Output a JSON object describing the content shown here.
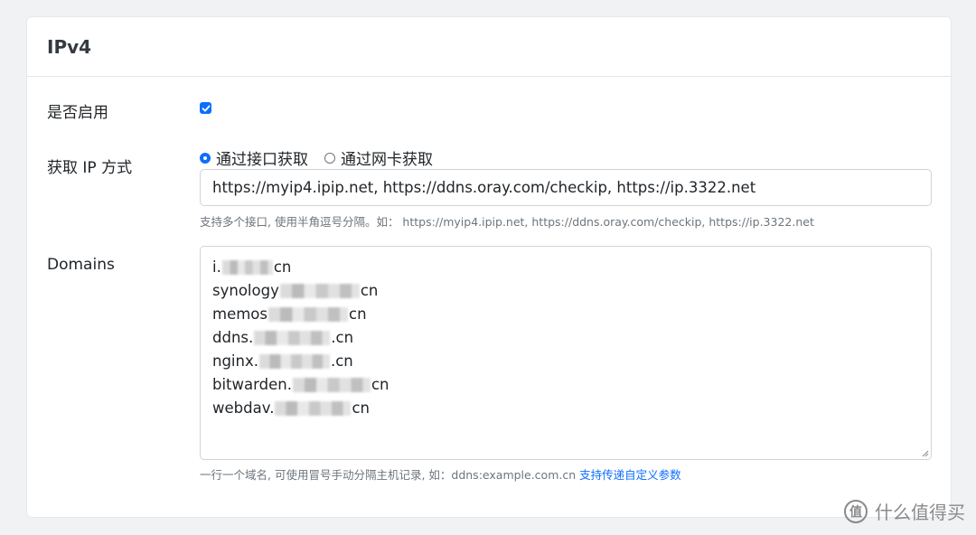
{
  "card": {
    "title": "IPv4"
  },
  "enable": {
    "label": "是否启用",
    "checked": true
  },
  "ip_method": {
    "label": "获取 IP 方式",
    "options": [
      {
        "label": "通过接口获取",
        "selected": true
      },
      {
        "label": "通过网卡获取",
        "selected": false
      }
    ],
    "input_value": "https://myip4.ipip.net, https://ddns.oray.com/checkip, https://ip.3322.net",
    "help": "支持多个接口, 使用半角逗号分隔。如：  https://myip4.ipip.net, https://ddns.oray.com/checkip, https://ip.3322.net"
  },
  "domains": {
    "label": "Domains",
    "lines": [
      {
        "prefix": "i.",
        "suffix": "cn"
      },
      {
        "prefix": "synology",
        "suffix": "cn"
      },
      {
        "prefix": "memos",
        "suffix": "cn"
      },
      {
        "prefix": "ddns.",
        "suffix": ".cn"
      },
      {
        "prefix": "nginx.",
        "suffix": ".cn"
      },
      {
        "prefix": "bitwarden.",
        "suffix": "cn"
      },
      {
        "prefix": "webdav.",
        "suffix": "cn"
      }
    ],
    "help": "一行一个域名, 可使用冒号手动分隔主机记录, 如：ddns:example.com.cn",
    "help_link": "支持传递自定义参数"
  },
  "watermark": {
    "text": "什么值得买",
    "icon": "值"
  },
  "colors": {
    "accent": "#0d6efd",
    "background": "#f1f2f4"
  }
}
